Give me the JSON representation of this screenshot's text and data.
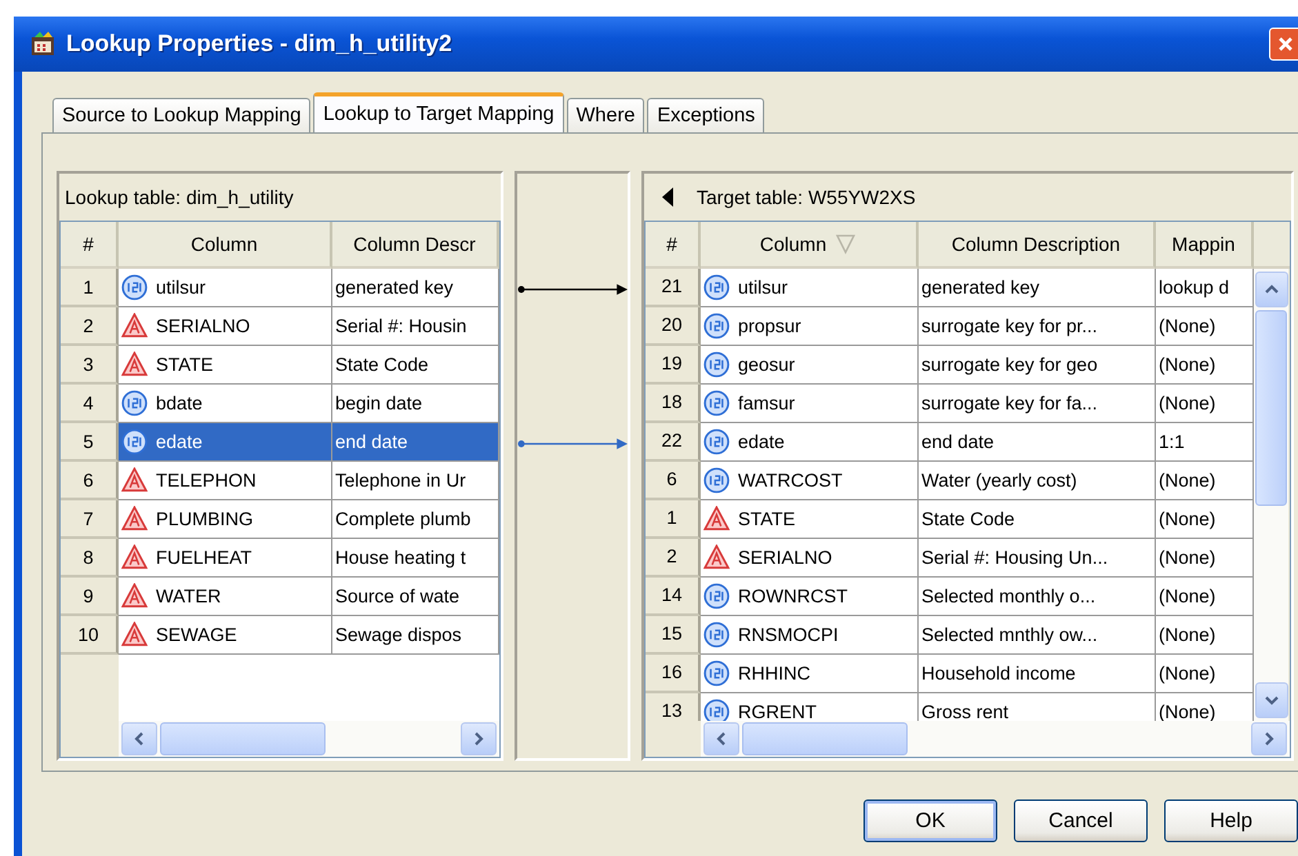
{
  "window": {
    "title": "Lookup Properties - dim_h_utility2"
  },
  "tabs": [
    {
      "label": "Source to Lookup Mapping",
      "selected": false
    },
    {
      "label": "Lookup to Target Mapping",
      "selected": true
    },
    {
      "label": "Where",
      "selected": false
    },
    {
      "label": "Exceptions",
      "selected": false
    }
  ],
  "lookup_table": {
    "title": "Lookup table: dim_h_utility",
    "columns": [
      {
        "label": "#"
      },
      {
        "label": "Column"
      },
      {
        "label": "Column Descr"
      }
    ],
    "rows": [
      {
        "number": "1",
        "kind": "numeric",
        "name": "utilsur",
        "description": "generated key",
        "selected": false,
        "mapped": true
      },
      {
        "number": "2",
        "kind": "character",
        "name": "SERIALNO",
        "description": "Serial #: Housin",
        "selected": false,
        "mapped": false
      },
      {
        "number": "3",
        "kind": "character",
        "name": "STATE",
        "description": "State Code",
        "selected": false,
        "mapped": false
      },
      {
        "number": "4",
        "kind": "numeric",
        "name": "bdate",
        "description": "begin date",
        "selected": false,
        "mapped": false
      },
      {
        "number": "5",
        "kind": "numeric",
        "name": "edate",
        "description": "end date",
        "selected": true,
        "mapped": true
      },
      {
        "number": "6",
        "kind": "character",
        "name": "TELEPHON",
        "description": "Telephone in Ur",
        "selected": false,
        "mapped": false
      },
      {
        "number": "7",
        "kind": "character",
        "name": "PLUMBING",
        "description": "Complete plumb",
        "selected": false,
        "mapped": false
      },
      {
        "number": "8",
        "kind": "character",
        "name": "FUELHEAT",
        "description": "House heating t",
        "selected": false,
        "mapped": false
      },
      {
        "number": "9",
        "kind": "character",
        "name": "WATER",
        "description": "Source of wate",
        "selected": false,
        "mapped": false
      },
      {
        "number": "10",
        "kind": "character",
        "name": "SEWAGE",
        "description": "Sewage dispos",
        "selected": false,
        "mapped": false
      }
    ]
  },
  "target_table": {
    "title": "Target table: W55YW2XS",
    "columns": [
      {
        "label": "#",
        "sorted": false
      },
      {
        "label": "Column",
        "sorted": true
      },
      {
        "label": "Column Description",
        "sorted": false
      },
      {
        "label": "Mappin",
        "sorted": false
      }
    ],
    "rows": [
      {
        "number": "21",
        "kind": "numeric",
        "name": "utilsur",
        "description": "generated key",
        "mapping": "lookup d"
      },
      {
        "number": "20",
        "kind": "numeric",
        "name": "propsur",
        "description": "surrogate key for pr...",
        "mapping": "(None)"
      },
      {
        "number": "19",
        "kind": "numeric",
        "name": "geosur",
        "description": "surrogate key for geo",
        "mapping": "(None)"
      },
      {
        "number": "18",
        "kind": "numeric",
        "name": "famsur",
        "description": "surrogate key for fa...",
        "mapping": "(None)"
      },
      {
        "number": "22",
        "kind": "numeric",
        "name": "edate",
        "description": "end date",
        "mapping": "1:1"
      },
      {
        "number": "6",
        "kind": "numeric",
        "name": "WATRCOST",
        "description": "Water (yearly cost)",
        "mapping": "(None)"
      },
      {
        "number": "1",
        "kind": "character",
        "name": "STATE",
        "description": "State Code",
        "mapping": "(None)"
      },
      {
        "number": "2",
        "kind": "character",
        "name": "SERIALNO",
        "description": "Serial #: Housing Un...",
        "mapping": "(None)"
      },
      {
        "number": "14",
        "kind": "numeric",
        "name": "ROWNRCST",
        "description": "Selected monthly o...",
        "mapping": "(None)"
      },
      {
        "number": "15",
        "kind": "numeric",
        "name": "RNSMOCPI",
        "description": "Selected mnthly ow...",
        "mapping": "(None)"
      },
      {
        "number": "16",
        "kind": "numeric",
        "name": "RHHINC",
        "description": "Household income",
        "mapping": "(None)"
      },
      {
        "number": "13",
        "kind": "numeric",
        "name": "RGRENT",
        "description": "Gross rent",
        "mapping": "(None)"
      }
    ]
  },
  "buttons": [
    {
      "label": "OK",
      "default": true
    },
    {
      "label": "Cancel",
      "default": false
    },
    {
      "label": "Help",
      "default": false
    }
  ]
}
